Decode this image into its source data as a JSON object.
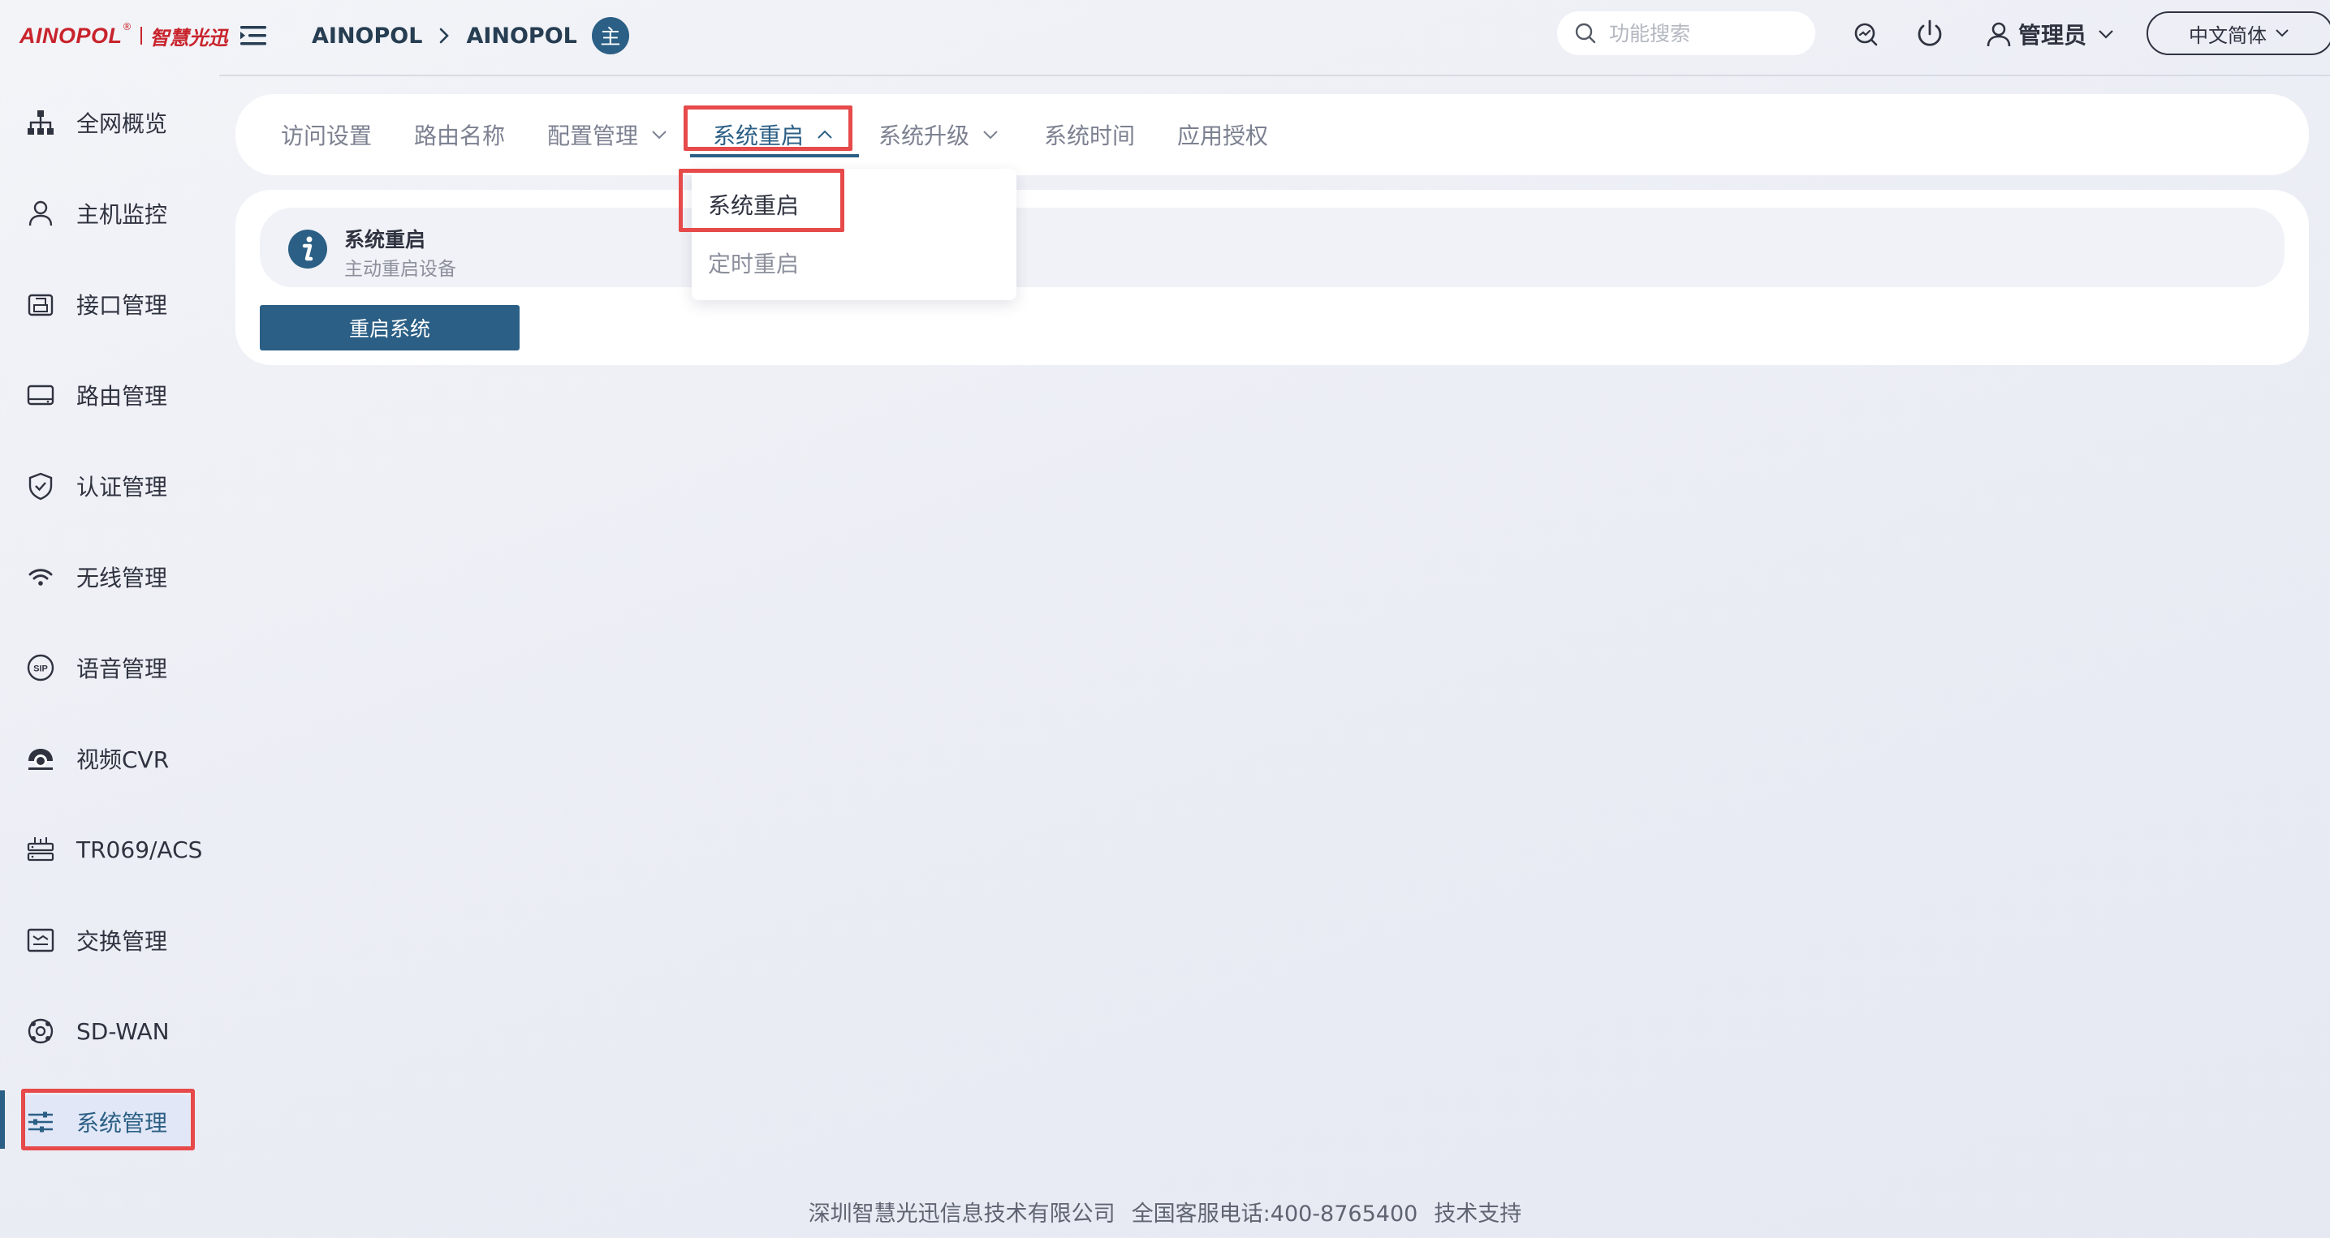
{
  "colors": {
    "accent": "#2b5f85",
    "highlight_red": "#e64a4a",
    "logo_red": "#c8232c"
  },
  "logo": {
    "brand": "AINOPOL",
    "reg_mark": "®",
    "tagline": "智慧光迅"
  },
  "breadcrumb": {
    "item1": "AINOPOL",
    "item2": "AINOPOL",
    "role_badge": "主"
  },
  "search": {
    "placeholder": "功能搜索"
  },
  "user": {
    "name": "管理员"
  },
  "language": {
    "selected": "中文简体"
  },
  "sidebar": {
    "items": [
      {
        "label": "全网概览",
        "icon": "network-topology-icon"
      },
      {
        "label": "主机监控",
        "icon": "user-icon"
      },
      {
        "label": "接口管理",
        "icon": "interface-icon"
      },
      {
        "label": "路由管理",
        "icon": "router-icon"
      },
      {
        "label": "认证管理",
        "icon": "shield-check-icon"
      },
      {
        "label": "无线管理",
        "icon": "wifi-icon"
      },
      {
        "label": "语音管理",
        "icon": "sip-icon"
      },
      {
        "label": "视频CVR",
        "icon": "camera-icon"
      },
      {
        "label": "TR069/ACS",
        "icon": "server-rack-icon"
      },
      {
        "label": "交换管理",
        "icon": "switch-icon"
      },
      {
        "label": "SD-WAN",
        "icon": "sdwan-icon"
      },
      {
        "label": "系统管理",
        "icon": "sliders-icon",
        "active": true
      }
    ]
  },
  "tabs": [
    {
      "label": "访问设置"
    },
    {
      "label": "路由名称"
    },
    {
      "label": "配置管理",
      "has_dropdown": true
    },
    {
      "label": "系统重启",
      "has_dropdown": true,
      "active": true
    },
    {
      "label": "系统升级",
      "has_dropdown": true
    },
    {
      "label": "系统时间"
    },
    {
      "label": "应用授权"
    }
  ],
  "dropdown": {
    "items": [
      {
        "label": "系统重启",
        "selected": true
      },
      {
        "label": "定时重启"
      }
    ]
  },
  "banner": {
    "title": "系统重启",
    "subtitle": "主动重启设备"
  },
  "reboot_button": {
    "label": "重启系统"
  },
  "footer": {
    "company": "深圳智慧光迅信息技术有限公司",
    "hotline": "全国客服电话:400-8765400",
    "support": "技术支持"
  }
}
